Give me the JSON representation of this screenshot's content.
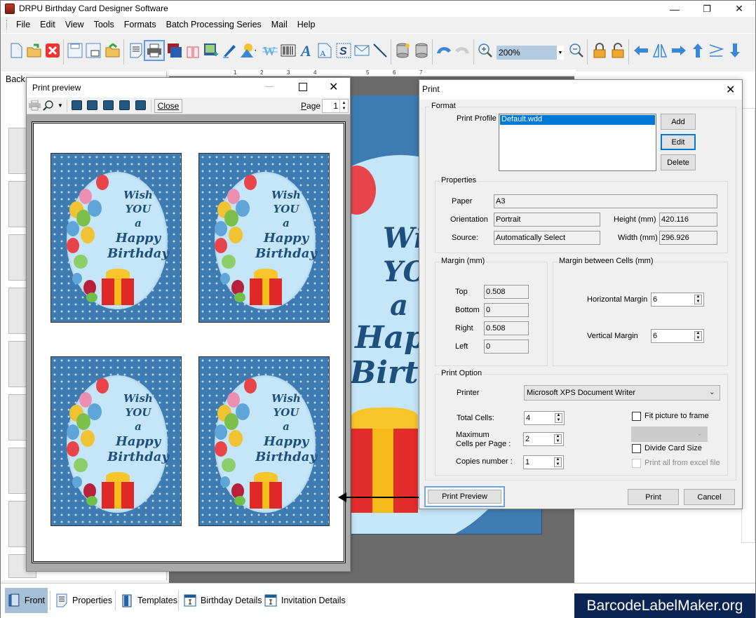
{
  "app": {
    "title": "DRPU Birthday Card Designer Software",
    "window_controls": {
      "minimize": "—",
      "maximize": "❐",
      "close": "✕"
    }
  },
  "menu": [
    "File",
    "Edit",
    "View",
    "Tools",
    "Formats",
    "Batch Processing Series",
    "Mail",
    "Help"
  ],
  "toolbar": {
    "buttons": [
      {
        "name": "new-icon"
      },
      {
        "name": "open-icon"
      },
      {
        "name": "close-file-icon"
      },
      {
        "name": "save-icon"
      },
      {
        "name": "save-as-icon"
      },
      {
        "name": "export-icon"
      },
      {
        "name": "properties-icon"
      },
      {
        "name": "print-icon",
        "active": true
      },
      {
        "name": "background-icon"
      },
      {
        "name": "gift-icon"
      },
      {
        "name": "insert-image-icon"
      },
      {
        "name": "pen-icon"
      },
      {
        "name": "shapes-icon"
      },
      {
        "name": "watermark-icon"
      },
      {
        "name": "barcode-icon"
      },
      {
        "name": "text-icon"
      },
      {
        "name": "text-file-icon"
      },
      {
        "name": "signature-icon"
      },
      {
        "name": "mail-icon"
      },
      {
        "name": "line-icon"
      },
      {
        "name": "database-import-icon"
      },
      {
        "name": "database-icon"
      },
      {
        "name": "undo-icon"
      },
      {
        "name": "redo-icon"
      },
      {
        "name": "zoom-in-icon"
      },
      {
        "name": "zoom-out-icon"
      },
      {
        "name": "lock-icon"
      },
      {
        "name": "unlock-icon"
      },
      {
        "name": "arrow-left-icon"
      },
      {
        "name": "flip-icon"
      },
      {
        "name": "arrow-right-icon"
      },
      {
        "name": "arrow-up-icon"
      },
      {
        "name": "align-icon"
      },
      {
        "name": "arrow-down-icon"
      }
    ],
    "zoom_value": "200%"
  },
  "left_panel": {
    "tab_label": "Back"
  },
  "ruler": {
    "ticks": [
      "1",
      "2",
      "3",
      "4",
      "5",
      "6",
      "7"
    ]
  },
  "card": {
    "lines": [
      "Wish",
      "YOU",
      "a",
      "Happy",
      "Birthday"
    ],
    "bg_color": "#3e7bb0",
    "oval_color": "#c5e5f8",
    "text_color": "#1f4f7c"
  },
  "print_preview": {
    "title": "Print preview",
    "close_label": "Close",
    "page_label": "Page",
    "page_value": "1",
    "cards_count": 4
  },
  "print_dialog": {
    "title": "Print",
    "format_legend": "Format",
    "print_profile_label": "Print Profile",
    "profiles": [
      "Default.wdd"
    ],
    "selected_profile": "Default.wdd",
    "add_label": "Add",
    "edit_label": "Edit",
    "delete_label": "Delete",
    "properties_legend": "Properties",
    "paper_label": "Paper",
    "paper_value": "A3",
    "orientation_label": "Orientation",
    "orientation_value": "Portrait",
    "source_label": "Source:",
    "source_value": "Automatically Select",
    "height_label": "Height (mm)",
    "height_value": "420.116",
    "width_label": "Width (mm)",
    "width_value": "296.926",
    "margin_legend": "Margin (mm)",
    "top_label": "Top",
    "top_value": "0.508",
    "bottom_label": "Bottom",
    "bottom_value": "0",
    "right_label": "Right",
    "right_value": "0.508",
    "left_label": "Left",
    "left_value": "0",
    "cell_margin_legend": "Margin between Cells (mm)",
    "horizontal_margin_label": "Horizontal Margin",
    "horizontal_margin_value": "6",
    "vertical_margin_label": "Vertical Margin",
    "vertical_margin_value": "6",
    "print_option_legend": "Print Option",
    "printer_label": "Printer",
    "printer_value": "Microsoft XPS Document Writer",
    "total_cells_label": "Total Cells:",
    "total_cells_value": "4",
    "max_cells_label_1": "Maximum",
    "max_cells_label_2": "Cells per Page :",
    "max_cells_value": "2",
    "copies_label": "Copies number :",
    "copies_value": "1",
    "fit_picture_label": "Fit picture to frame",
    "fit_picture_checked": false,
    "divide_card_label": "Divide Card Size",
    "divide_card_checked": false,
    "print_excel_label": "Print all from excel file",
    "print_excel_enabled": false,
    "print_preview_label": "Print Preview",
    "print_label": "Print",
    "cancel_label": "Cancel"
  },
  "bottom_tabs": [
    {
      "label": "Front",
      "icon": "front-page-icon",
      "active": true
    },
    {
      "label": "Properties",
      "icon": "properties-icon"
    },
    {
      "label": "Templates",
      "icon": "templates-icon"
    },
    {
      "label": "Birthday Details",
      "icon": "details-form-icon"
    },
    {
      "label": "Invitation Details",
      "icon": "details-form-icon"
    }
  ],
  "brand": "BarcodeLabelMaker.org"
}
